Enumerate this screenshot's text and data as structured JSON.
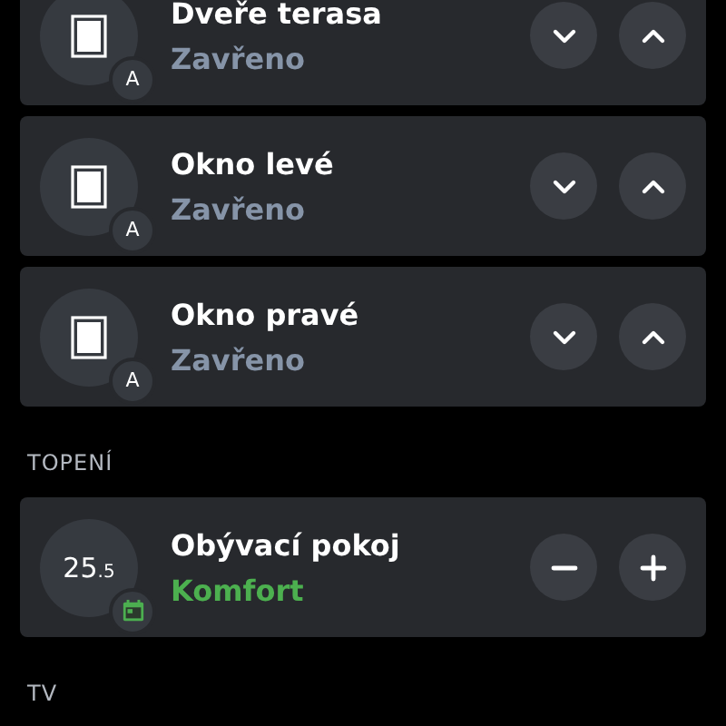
{
  "sections": [
    {
      "cards": [
        {
          "kind": "cover",
          "name": "Dveře terasa",
          "status": "Zavřeno",
          "badge": "A",
          "buttons": [
            {
              "kind": "down"
            },
            {
              "kind": "up"
            }
          ]
        },
        {
          "kind": "cover",
          "name": "Okno levé",
          "status": "Zavřeno",
          "badge": "A",
          "buttons": [
            {
              "kind": "down"
            },
            {
              "kind": "up"
            }
          ]
        },
        {
          "kind": "cover",
          "name": "Okno pravé",
          "status": "Zavřeno",
          "badge": "A",
          "buttons": [
            {
              "kind": "down"
            },
            {
              "kind": "up"
            }
          ]
        }
      ]
    },
    {
      "title": "TOPENÍ",
      "cards": [
        {
          "kind": "thermostat",
          "name": "Obývací pokoj",
          "status": "Komfort",
          "temperature": "25$_{.5}$",
          "buttons": [
            {
              "kind": "minus"
            },
            {
              "kind": "plus"
            }
          ]
        }
      ]
    },
    {
      "title": "TV"
    }
  ]
}
